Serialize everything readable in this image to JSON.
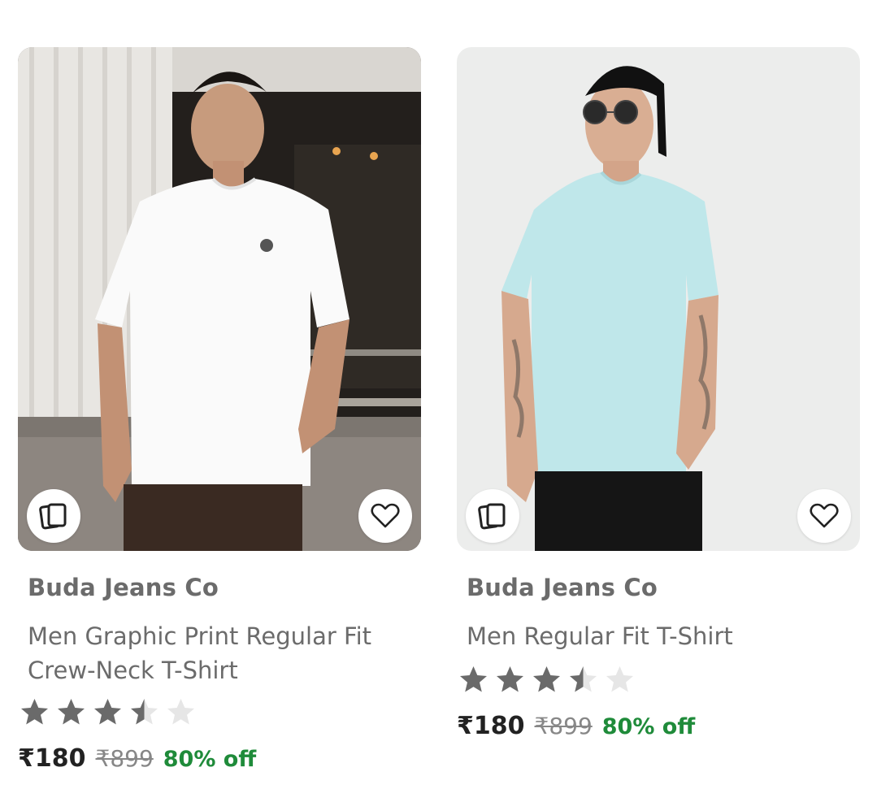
{
  "products": [
    {
      "brand": "Buda Jeans Co",
      "title_line1": "Men Graphic Print Regular Fit",
      "title_line2": "Crew-Neck T-Shirt",
      "rating": 3.5,
      "price": "₹180",
      "mrp": "₹899",
      "discount": "80% off",
      "shirt_color": "#fafafa",
      "similar_icon": "similar-products-icon",
      "wishlist_icon": "heart-icon"
    },
    {
      "brand": "Buda Jeans Co",
      "title_line1": "Men Regular Fit T-Shirt",
      "title_line2": "",
      "rating": 3.5,
      "price": "₹180",
      "mrp": "₹899",
      "discount": "80% off",
      "shirt_color": "#bfe7ea",
      "similar_icon": "similar-products-icon",
      "wishlist_icon": "heart-icon"
    }
  ],
  "colors": {
    "text_secondary": "#6b6b6b",
    "price": "#222222",
    "mrp": "#878787",
    "discount": "#1f8b3a",
    "star_filled": "#6a6a6a",
    "star_empty": "#e6e6e6"
  }
}
